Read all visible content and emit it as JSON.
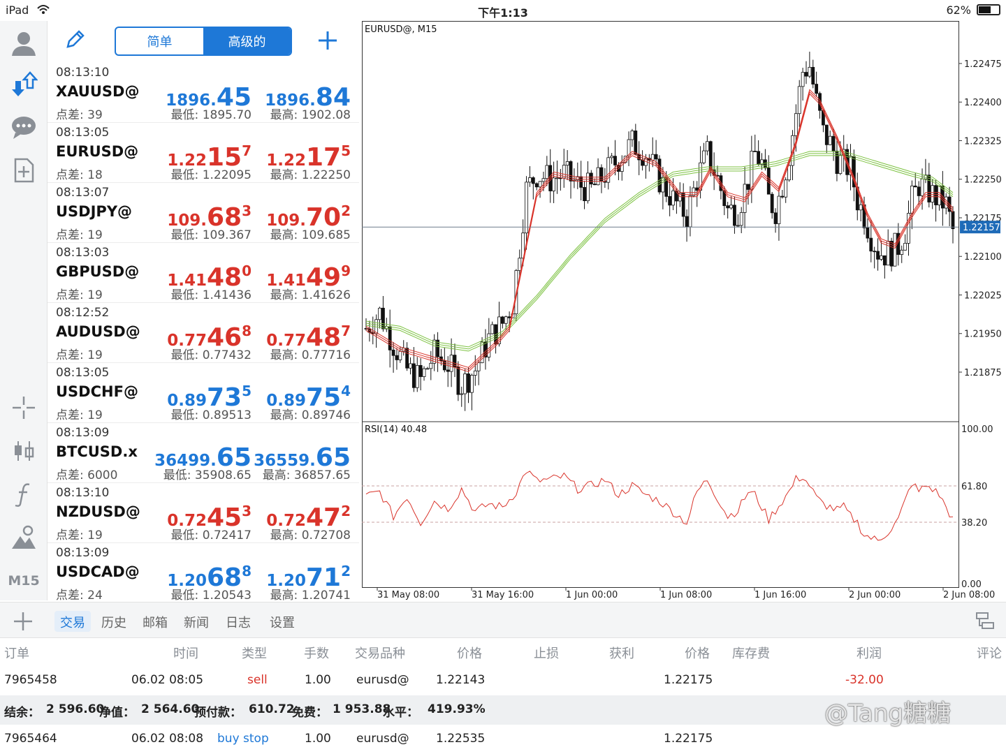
{
  "status_bar": {
    "device": "iPad",
    "time": "下午1:13",
    "battery": "62%",
    "battery_level": 0.62
  },
  "rail": {
    "timeframe": "M15"
  },
  "quotes_header": {
    "segments": [
      "简单",
      "高级的"
    ],
    "active_segment": 1
  },
  "quotes": [
    {
      "time": "08:13:10",
      "symbol": "XAUUSD@",
      "bid": [
        "1896.",
        "45",
        ""
      ],
      "ask": [
        "1896.",
        "84",
        ""
      ],
      "dir": "up",
      "spread": "点差: 39",
      "low": "最低: 1895.70",
      "high": "最高: 1902.08"
    },
    {
      "time": "08:13:05",
      "symbol": "EURUSD@",
      "bid": [
        "1.22",
        "15",
        "7"
      ],
      "ask": [
        "1.22",
        "17",
        "5"
      ],
      "dir": "dn",
      "spread": "点差: 18",
      "low": "最低: 1.22095",
      "high": "最高: 1.22250"
    },
    {
      "time": "08:13:07",
      "symbol": "USDJPY@",
      "bid": [
        "109.",
        "68",
        "3"
      ],
      "ask": [
        "109.",
        "70",
        "2"
      ],
      "dir": "dn",
      "spread": "点差: 19",
      "low": "最低: 109.367",
      "high": "最高: 109.685"
    },
    {
      "time": "08:13:03",
      "symbol": "GBPUSD@",
      "bid": [
        "1.41",
        "48",
        "0"
      ],
      "ask": [
        "1.41",
        "49",
        "9"
      ],
      "dir": "dn",
      "spread": "点差: 19",
      "low": "最低: 1.41436",
      "high": "最高: 1.41626"
    },
    {
      "time": "08:12:52",
      "symbol": "AUDUSD@",
      "bid": [
        "0.77",
        "46",
        "8"
      ],
      "ask": [
        "0.77",
        "48",
        "7"
      ],
      "dir": "dn",
      "spread": "点差: 19",
      "low": "最低: 0.77432",
      "high": "最高: 0.77716"
    },
    {
      "time": "08:13:05",
      "symbol": "USDCHF@",
      "bid": [
        "0.89",
        "73",
        "5"
      ],
      "ask": [
        "0.89",
        "75",
        "4"
      ],
      "dir": "up",
      "spread": "点差: 19",
      "low": "最低: 0.89513",
      "high": "最高: 0.89746"
    },
    {
      "time": "08:13:09",
      "symbol": "BTCUSD.x",
      "bid": [
        "36499.",
        "65",
        ""
      ],
      "ask": [
        "36559.",
        "65",
        ""
      ],
      "dir": "up",
      "spread": "点差: 6000",
      "low": "最低: 35908.65",
      "high": "最高: 36857.65"
    },
    {
      "time": "08:13:10",
      "symbol": "NZDUSD@",
      "bid": [
        "0.72",
        "45",
        "3"
      ],
      "ask": [
        "0.72",
        "47",
        "2"
      ],
      "dir": "dn",
      "spread": "点差: 19",
      "low": "最低: 0.72417",
      "high": "最高: 0.72708"
    },
    {
      "time": "08:13:09",
      "symbol": "USDCAD@",
      "bid": [
        "1.20",
        "68",
        "8"
      ],
      "ask": [
        "1.20",
        "71",
        "2"
      ],
      "dir": "up",
      "spread": "点差: 24",
      "low": "最低: 1.20543",
      "high": "最高: 1.20741"
    }
  ],
  "colors": {
    "accent": "#1e78d7",
    "down": "#d9332a",
    "ma_fast": "#d9332a",
    "ma_slow": "#7dc242",
    "rsi": "#d9332a"
  },
  "chart_data": {
    "type": "candlestick",
    "title": "EURUSD@, M15",
    "price_axis": [
      "1.22475",
      "1.22400",
      "1.22325",
      "1.22250",
      "1.22175",
      "1.22100",
      "1.22025",
      "1.21950",
      "1.21875"
    ],
    "price_range": [
      1.2178,
      1.22555
    ],
    "current_price": "1.22157",
    "x_labels": [
      "31 May 08:00",
      "31 May 16:00",
      "1 Jun 00:00",
      "1 Jun 08:00",
      "1 Jun 16:00",
      "2 Jun 00:00",
      "2 Jun 08:00"
    ],
    "close_path": [
      [
        0,
        1.2196
      ],
      [
        4,
        1.2199
      ],
      [
        8,
        1.2193
      ],
      [
        12,
        1.2188
      ],
      [
        16,
        1.2186
      ],
      [
        20,
        1.2191
      ],
      [
        24,
        1.2189
      ],
      [
        28,
        1.2185
      ],
      [
        32,
        1.2188
      ],
      [
        36,
        1.2194
      ],
      [
        40,
        1.2197
      ],
      [
        43,
        1.2201
      ],
      [
        45,
        1.2212
      ],
      [
        47,
        1.2223
      ],
      [
        50,
        1.2226
      ],
      [
        54,
        1.2225
      ],
      [
        58,
        1.2226
      ],
      [
        62,
        1.2224
      ],
      [
        66,
        1.2223
      ],
      [
        70,
        1.2226
      ],
      [
        74,
        1.2229
      ],
      [
        78,
        1.2232
      ],
      [
        82,
        1.223
      ],
      [
        86,
        1.2225
      ],
      [
        90,
        1.2221
      ],
      [
        94,
        1.2218
      ],
      [
        97,
        1.2225
      ],
      [
        100,
        1.223
      ],
      [
        103,
        1.2225
      ],
      [
        106,
        1.2219
      ],
      [
        109,
        1.2219
      ],
      [
        112,
        1.2225
      ],
      [
        114,
        1.223
      ],
      [
        116,
        1.2228
      ],
      [
        118,
        1.2221
      ],
      [
        120,
        1.2219
      ],
      [
        122,
        1.2224
      ],
      [
        124,
        1.223
      ],
      [
        126,
        1.2238
      ],
      [
        128,
        1.2246
      ],
      [
        130,
        1.2247
      ],
      [
        132,
        1.224
      ],
      [
        134,
        1.2234
      ],
      [
        136,
        1.2232
      ],
      [
        138,
        1.2229
      ],
      [
        140,
        1.2228
      ],
      [
        142,
        1.2227
      ],
      [
        144,
        1.2221
      ],
      [
        146,
        1.2218
      ],
      [
        148,
        1.2214
      ],
      [
        150,
        1.2211
      ],
      [
        152,
        1.22105
      ],
      [
        154,
        1.2211
      ],
      [
        156,
        1.2212
      ],
      [
        158,
        1.2215
      ],
      [
        160,
        1.2221
      ],
      [
        162,
        1.2224
      ],
      [
        164,
        1.2223
      ],
      [
        166,
        1.2222
      ],
      [
        168,
        1.2221
      ],
      [
        170,
        1.222
      ],
      [
        172,
        1.2215
      ]
    ],
    "ma_fast": [
      [
        0,
        1.2196
      ],
      [
        10,
        1.2192
      ],
      [
        20,
        1.219
      ],
      [
        30,
        1.2188
      ],
      [
        38,
        1.2193
      ],
      [
        42,
        1.2196
      ],
      [
        46,
        1.2209
      ],
      [
        50,
        1.2222
      ],
      [
        55,
        1.2226
      ],
      [
        62,
        1.2225
      ],
      [
        70,
        1.2225
      ],
      [
        78,
        1.223
      ],
      [
        85,
        1.2228
      ],
      [
        92,
        1.2222
      ],
      [
        97,
        1.2222
      ],
      [
        101,
        1.2227
      ],
      [
        106,
        1.2222
      ],
      [
        111,
        1.2221
      ],
      [
        116,
        1.2226
      ],
      [
        121,
        1.2223
      ],
      [
        126,
        1.2232
      ],
      [
        130,
        1.2242
      ],
      [
        133,
        1.224
      ],
      [
        138,
        1.2233
      ],
      [
        143,
        1.2225
      ],
      [
        147,
        1.2218
      ],
      [
        151,
        1.2213
      ],
      [
        155,
        1.2212
      ],
      [
        160,
        1.2218
      ],
      [
        164,
        1.2222
      ],
      [
        168,
        1.2222
      ],
      [
        172,
        1.2219
      ]
    ],
    "ma_slow": [
      [
        0,
        1.2197
      ],
      [
        10,
        1.2196
      ],
      [
        20,
        1.2193
      ],
      [
        30,
        1.2192
      ],
      [
        40,
        1.2195
      ],
      [
        50,
        1.2202
      ],
      [
        60,
        1.221
      ],
      [
        70,
        1.2217
      ],
      [
        80,
        1.2222
      ],
      [
        90,
        1.2226
      ],
      [
        100,
        1.2227
      ],
      [
        110,
        1.2227
      ],
      [
        120,
        1.2228
      ],
      [
        130,
        1.223
      ],
      [
        140,
        1.223
      ],
      [
        150,
        1.2228
      ],
      [
        160,
        1.2226
      ],
      [
        166,
        1.2225
      ],
      [
        172,
        1.2222
      ]
    ],
    "rsi": {
      "label": "RSI(14) 40.48",
      "axis": [
        "100.00",
        "61.80",
        "38.20",
        "0.00"
      ],
      "levels": [
        61.8,
        38.2
      ],
      "values": [
        [
          0,
          55
        ],
        [
          4,
          58
        ],
        [
          8,
          42
        ],
        [
          12,
          55
        ],
        [
          16,
          38
        ],
        [
          20,
          52
        ],
        [
          24,
          47
        ],
        [
          28,
          60
        ],
        [
          32,
          45
        ],
        [
          36,
          50
        ],
        [
          40,
          48
        ],
        [
          44,
          58
        ],
        [
          47,
          72
        ],
        [
          50,
          65
        ],
        [
          54,
          66
        ],
        [
          58,
          68
        ],
        [
          62,
          60
        ],
        [
          66,
          62
        ],
        [
          70,
          66
        ],
        [
          74,
          56
        ],
        [
          78,
          62
        ],
        [
          82,
          56
        ],
        [
          86,
          52
        ],
        [
          90,
          45
        ],
        [
          94,
          38
        ],
        [
          97,
          58
        ],
        [
          100,
          66
        ],
        [
          103,
          54
        ],
        [
          106,
          42
        ],
        [
          109,
          46
        ],
        [
          112,
          58
        ],
        [
          114,
          56
        ],
        [
          116,
          48
        ],
        [
          118,
          40
        ],
        [
          120,
          46
        ],
        [
          122,
          52
        ],
        [
          124,
          58
        ],
        [
          126,
          66
        ],
        [
          128,
          68
        ],
        [
          130,
          62
        ],
        [
          132,
          54
        ],
        [
          134,
          50
        ],
        [
          136,
          48
        ],
        [
          138,
          46
        ],
        [
          140,
          48
        ],
        [
          142,
          42
        ],
        [
          144,
          38
        ],
        [
          146,
          30
        ],
        [
          148,
          28
        ],
        [
          150,
          26
        ],
        [
          152,
          30
        ],
        [
          154,
          34
        ],
        [
          156,
          40
        ],
        [
          158,
          52
        ],
        [
          160,
          64
        ],
        [
          162,
          58
        ],
        [
          164,
          62
        ],
        [
          166,
          60
        ],
        [
          168,
          56
        ],
        [
          170,
          48
        ],
        [
          172,
          40
        ]
      ]
    },
    "candle_count": 173
  },
  "bottom_tabs": [
    "交易",
    "历史",
    "邮箱",
    "新闻",
    "日志",
    "设置"
  ],
  "active_tab": 0,
  "table": {
    "headers": [
      "订单",
      "时间",
      "类型",
      "手数",
      "交易品种",
      "价格",
      "止损",
      "获利",
      "价格",
      "库存费",
      "利润",
      "评论"
    ],
    "rows": [
      [
        "7965458",
        "06.02 08:05",
        "sell",
        "1.00",
        "eurusd@",
        "1.22143",
        "",
        "",
        "1.22175",
        "",
        "-32.00",
        ""
      ],
      [
        "7965464",
        "06.02 08:08",
        "buy stop",
        "1.00",
        "eurusd@",
        "1.22535",
        "",
        "",
        "1.22175",
        "",
        "",
        ""
      ]
    ],
    "summary": [
      "结余：",
      "2 596.60",
      "净值：",
      "2 564.60",
      "预付款：",
      "610.72",
      "免费：",
      "1 953.88",
      "水平：",
      "419.93%"
    ],
    "watermark": "@Tang糖糖"
  }
}
